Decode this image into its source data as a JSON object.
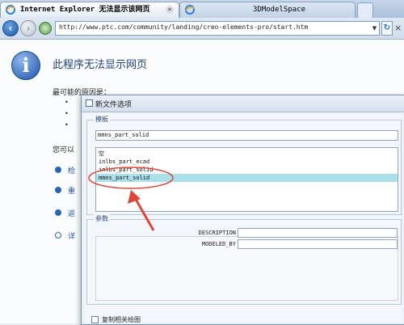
{
  "browser": {
    "tabs": [
      {
        "label": "Internet Explorer 无法显示该网页",
        "active": true
      },
      {
        "label": "3DModelSpace",
        "active": false
      }
    ],
    "address": "http://www.ptc.com/community/landing/creo-elements-pro/start.htm"
  },
  "error_page": {
    "title": "此程序无法显示网页",
    "cause_heading": "最可能的原因是：",
    "try_heading": "您可以",
    "try_items": [
      "检",
      "重",
      "返",
      "详"
    ]
  },
  "dialog": {
    "title": "新文件选项",
    "template_group": "模板",
    "template_value": "mmns_part_solid",
    "template_list": [
      "空",
      "inlbs_part_ecad",
      "inlbs_part_solid",
      "mmns_part_solid"
    ],
    "selected_index": 3,
    "params_group": "参数",
    "params": [
      {
        "name": "DESCRIPTION",
        "value": ""
      },
      {
        "name": "MODELED_BY",
        "value": ""
      }
    ],
    "copy_label": "复制相关绘图"
  },
  "colors": {
    "selection": "#a9e0ea",
    "annotation": "#e0453a"
  }
}
